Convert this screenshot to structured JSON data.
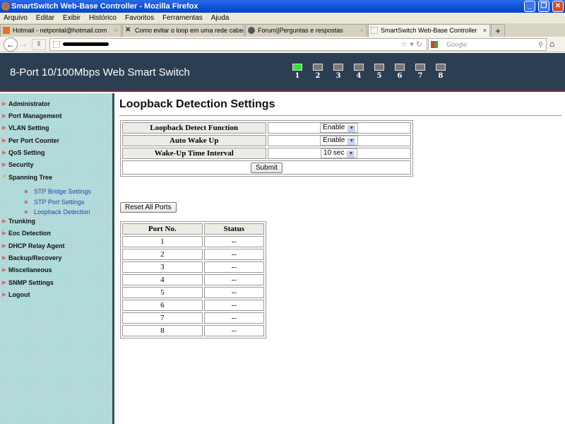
{
  "window": {
    "title": "SmartSwitch Web-Base Controller - Mozilla Firefox"
  },
  "menu": [
    "Arquivo",
    "Editar",
    "Exibir",
    "Histórico",
    "Favoritos",
    "Ferramentas",
    "Ajuda"
  ],
  "tabs": [
    {
      "label": "Hotmail - netpontal@hotmail.com"
    },
    {
      "label": "Como evitar o loop em uma rede cabead..."
    },
    {
      "label": "Forum||Perguntas e respostas"
    },
    {
      "label": "SmartSwitch Web-Base Controller",
      "active": true
    }
  ],
  "search": {
    "placeholder": "Google"
  },
  "header": {
    "title": "8-Port 10/100Mbps Web Smart Switch",
    "ports": [
      {
        "n": "1",
        "link": true
      },
      {
        "n": "2",
        "link": false
      },
      {
        "n": "3",
        "link": false
      },
      {
        "n": "4",
        "link": false
      },
      {
        "n": "5",
        "link": false
      },
      {
        "n": "6",
        "link": false
      },
      {
        "n": "7",
        "link": false
      },
      {
        "n": "8",
        "link": false
      }
    ]
  },
  "sidebar": {
    "items": [
      "Administrator",
      "Port Management",
      "VLAN Setting",
      "Per Port Counter",
      "QoS Setting",
      "Security",
      "Spanning Tree",
      "Trunking",
      "Eoc Detection",
      "DHCP Relay Agent",
      "Backup/Recovery",
      "Miscellaneous",
      "SNMP Settings",
      "Logout"
    ],
    "sub": [
      "STP Bridge Settings",
      "STP Port Settings",
      "Loopback Detection"
    ]
  },
  "page": {
    "title": "Loopback Detection Settings",
    "settings": [
      {
        "label": "Loopback Detect Function",
        "value": "Enable"
      },
      {
        "label": "Auto Wake Up",
        "value": "Enable"
      },
      {
        "label": "Wake-Up Time Interval",
        "value": "10 sec"
      }
    ],
    "submit": "Submit",
    "reset": "Reset All Ports",
    "ports_table": {
      "headers": [
        "Port No.",
        "Status"
      ],
      "rows": [
        [
          "1",
          "--"
        ],
        [
          "2",
          "--"
        ],
        [
          "3",
          "--"
        ],
        [
          "4",
          "--"
        ],
        [
          "5",
          "--"
        ],
        [
          "6",
          "--"
        ],
        [
          "7",
          "--"
        ],
        [
          "8",
          "--"
        ]
      ]
    }
  }
}
